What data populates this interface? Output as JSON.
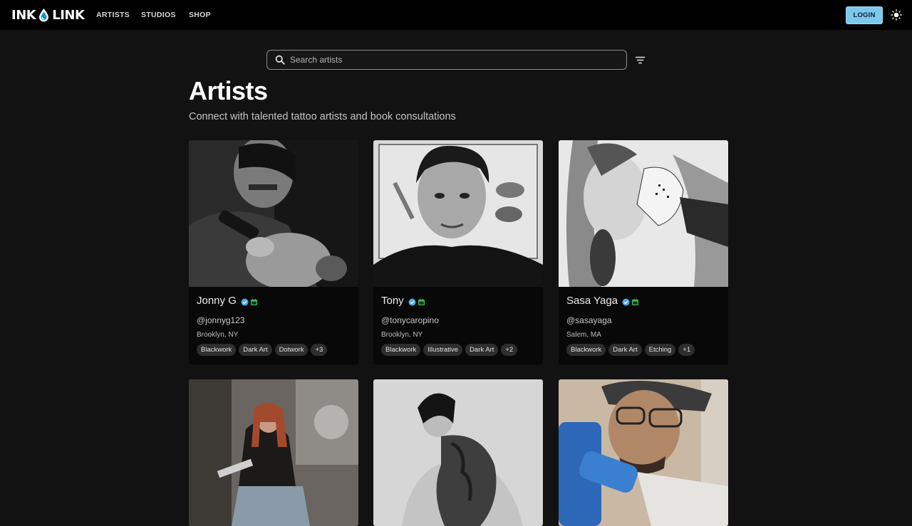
{
  "brand": {
    "left": "INK",
    "right": "LINK"
  },
  "nav": [
    {
      "label": "ARTISTS"
    },
    {
      "label": "STUDIOS"
    },
    {
      "label": "SHOP"
    }
  ],
  "auth": {
    "login_label": "LOGIN"
  },
  "search": {
    "placeholder": "Search artists"
  },
  "page": {
    "title": "Artists",
    "subtitle": "Connect with talented tattoo artists and book consultations"
  },
  "colors": {
    "accent": "#7cc8ec",
    "verified": "#4aa8e8",
    "calendar": "#3fb85a",
    "card_bg": "#080808"
  },
  "icons": [
    "ink-drop-icon",
    "sun-icon",
    "search-icon",
    "filter-icon",
    "verified-icon",
    "calendar-icon"
  ],
  "artists": [
    {
      "name": "Jonny G",
      "handle": "@jonnyg123",
      "location": "Brooklyn, NY",
      "tags": [
        "Blackwork",
        "Dark Art",
        "Dotwork",
        "+3"
      ]
    },
    {
      "name": "Tony",
      "handle": "@tonycaropino",
      "location": "Brooklyn, NY",
      "tags": [
        "Blackwork",
        "Illustrative",
        "Dark Art",
        "+2"
      ]
    },
    {
      "name": "Sasa Yaga",
      "handle": "@sasayaga",
      "location": "Salem, MA",
      "tags": [
        "Blackwork",
        "Dark Art",
        "Etching",
        "+1"
      ]
    }
  ]
}
